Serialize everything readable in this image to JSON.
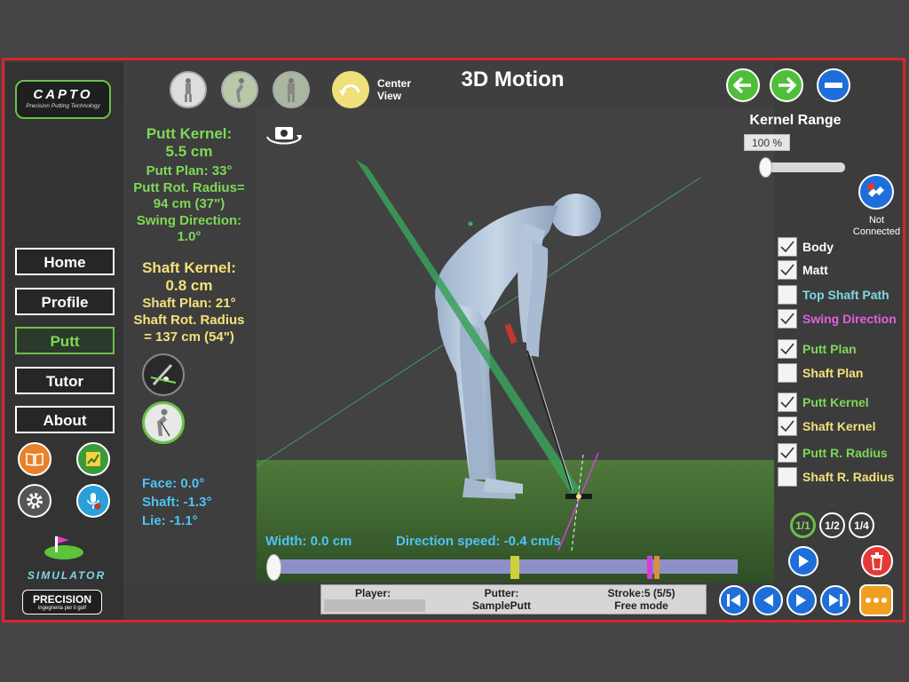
{
  "brand": {
    "logo_text": "CAPTO",
    "logo_tagline": "Precision Putting Technology",
    "simulator_label": "SIMULATOR",
    "precision_label": "PRECISION",
    "precision_tagline": "ingegneria per il golf"
  },
  "nav": {
    "items": [
      {
        "label": "Home",
        "active": false
      },
      {
        "label": "Profile",
        "active": false
      },
      {
        "label": "Putt",
        "active": true
      },
      {
        "label": "Tutor",
        "active": false
      },
      {
        "label": "About",
        "active": false
      }
    ]
  },
  "header": {
    "title": "3D Motion",
    "center_view_line1": "Center",
    "center_view_line2": "View"
  },
  "putt_stats": {
    "kernel_label": "Putt Kernel:",
    "kernel_value": "5.5 cm",
    "plan": "Putt Plan: 33°",
    "rot_radius_line1": "Putt Rot. Radius=",
    "rot_radius_line2": "94 cm  (37\")",
    "swing_dir_label": "Swing Direction:",
    "swing_dir_value": "1.0°"
  },
  "shaft_stats": {
    "kernel_label": "Shaft Kernel:",
    "kernel_value": "0.8 cm",
    "plan": "Shaft Plan: 21°",
    "rot_radius_line1": "Shaft Rot. Radius",
    "rot_radius_line2": "= 137 cm  (54\")"
  },
  "angles": {
    "face": "Face: 0.0°",
    "shaft": "Shaft: -1.3°",
    "lie": "Lie: -1.1°"
  },
  "viewport": {
    "width_readout": "Width: 0.0 cm",
    "direction_speed": "Direction speed: -0.4 cm/s"
  },
  "kernel_range": {
    "label": "Kernel Range",
    "value": "100 %",
    "slider_fraction": 0.0
  },
  "connection": {
    "status_line1": "Not",
    "status_line2": "Connected"
  },
  "toggles": [
    {
      "label": "Body",
      "checked": true,
      "color": "#ffffff"
    },
    {
      "label": "Matt",
      "checked": true,
      "color": "#ffffff"
    },
    {
      "label": "Top Shaft Path",
      "checked": false,
      "color": "#7fd6e6"
    },
    {
      "label": "Swing Direction",
      "checked": true,
      "color": "#e060e0"
    },
    {
      "label": "Putt Plan",
      "checked": true,
      "color": "#7ed957"
    },
    {
      "label": "Shaft Plan",
      "checked": false,
      "color": "#f5e17a"
    },
    {
      "label": "Putt Kernel",
      "checked": true,
      "color": "#7ed957"
    },
    {
      "label": "Shaft Kernel",
      "checked": true,
      "color": "#f5e17a"
    },
    {
      "label": "Putt R. Radius",
      "checked": true,
      "color": "#7ed957"
    },
    {
      "label": "Shaft R. Radius",
      "checked": false,
      "color": "#f5e17a"
    }
  ],
  "playback": {
    "ratios": [
      "1/1",
      "1/2",
      "1/4"
    ],
    "active_ratio": "1/1",
    "timeline_position": 0.0
  },
  "status": {
    "player_label": "Player:",
    "player_value": "",
    "putter_label": "Putter:",
    "putter_value": "SamplePutt",
    "stroke_label": "Stroke:5 (5/5)",
    "mode": "Free mode"
  },
  "icons": [
    "capto-logo",
    "golfer-front-icon",
    "golfer-side-icon",
    "golfer-back-icon",
    "center-view-icon",
    "camera-rotate-icon",
    "arrow-left-icon",
    "arrow-right-icon",
    "minus-icon",
    "book-icon",
    "chart-icon",
    "gear-icon",
    "microphone-icon",
    "plug-icon",
    "play-icon",
    "trash-icon",
    "skip-first-icon",
    "prev-icon",
    "next-icon",
    "skip-last-icon",
    "more-icon"
  ],
  "colors": {
    "accent_green": "#7ed957",
    "accent_yellow": "#f5e17a",
    "frame_red": "#d8262b",
    "button_blue": "#1e6fd9"
  }
}
